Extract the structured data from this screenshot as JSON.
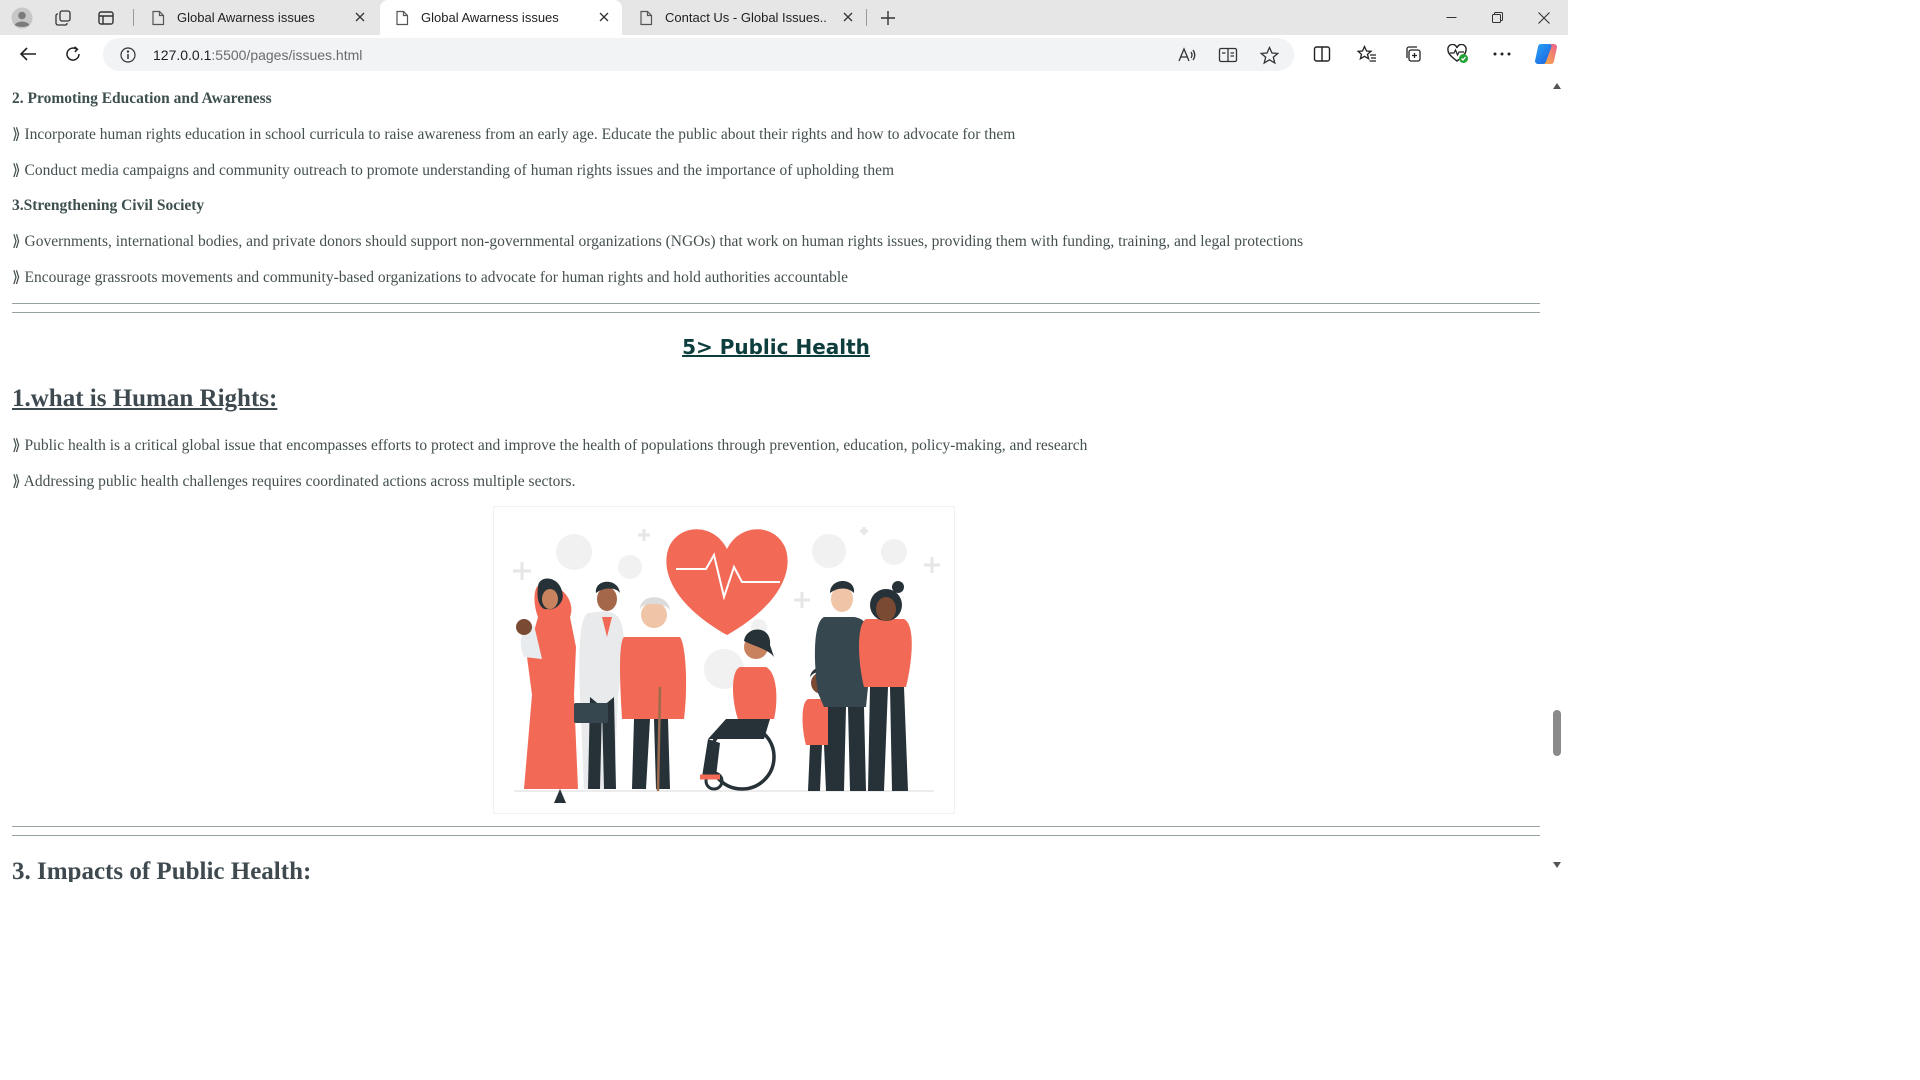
{
  "browser": {
    "tabs": [
      {
        "title": "Global Awarness issues",
        "active": false
      },
      {
        "title": "Global Awarness issues",
        "active": true
      },
      {
        "title": "Contact Us - Global Issues..",
        "active": false
      }
    ],
    "address": {
      "host": "127.0.0.1",
      "path": ":5500/pages/issues.html"
    },
    "accent_color": "#1a73e8"
  },
  "page": {
    "sections": {
      "education_heading": "2. Promoting Education and Awareness",
      "education_points": [
        "⟫ Incorporate human rights education in school curricula to raise awareness from an early age. Educate the public about their rights and how to advocate for them",
        "⟫ Conduct media campaigns and community outreach to promote understanding of human rights issues and the importance of upholding them"
      ],
      "civil_heading": "3.Strengthening Civil Society",
      "civil_points": [
        "⟫ Governments, international bodies, and private donors should support non-governmental organizations (NGOs) that work on human rights issues, providing them with funding, training, and legal protections",
        "⟫ Encourage grassroots movements and community-based organizations to advocate for human rights and hold authorities accountable"
      ],
      "public_health_title": "5> Public Health",
      "what_is_heading": "1.what is Human Rights:",
      "health_points": [
        "⟫ Public health is a critical global issue that encompasses efforts to protect and improve the health of populations through prevention, education, policy-making, and research",
        "⟫ Addressing public health challenges requires coordinated actions across multiple sectors."
      ],
      "impacts_heading": "3. Impacts of Public Health:"
    },
    "illustration": {
      "name": "public-health-community-illustration",
      "accent": "#f26a56"
    }
  }
}
